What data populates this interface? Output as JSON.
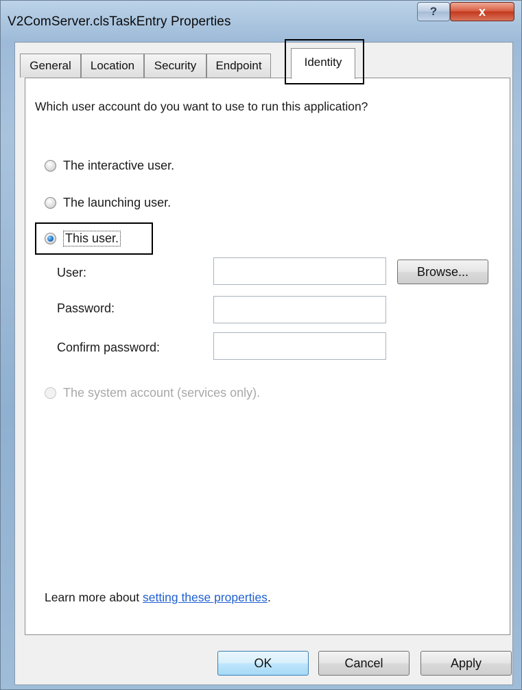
{
  "window": {
    "title": "V2ComServer.clsTaskEntry Properties",
    "help_glyph": "?",
    "close_glyph": "x"
  },
  "tabs": [
    {
      "label": "General"
    },
    {
      "label": "Location"
    },
    {
      "label": "Security"
    },
    {
      "label": "Endpoint"
    },
    {
      "label": "Identity",
      "active": true
    }
  ],
  "identity": {
    "question": "Which user account do you want to use to run this application?",
    "options": {
      "interactive": "The interactive user.",
      "launching": "The launching user.",
      "this_user": "This user.",
      "system": "The system account (services only)."
    },
    "selected_option": "this_user",
    "fields": {
      "user_label": "User:",
      "user_value": "",
      "password_label": "Password:",
      "password_value": "",
      "confirm_label": "Confirm password:",
      "confirm_value": ""
    },
    "browse_label": "Browse...",
    "learn_prefix": "Learn more about ",
    "learn_link": "setting these properties",
    "learn_suffix": "."
  },
  "buttons": {
    "ok": "OK",
    "cancel": "Cancel",
    "apply": "Apply"
  },
  "colors": {
    "link": "#1f5fd0",
    "close_button": "#c33a1e",
    "frame": "#9dbad8"
  }
}
